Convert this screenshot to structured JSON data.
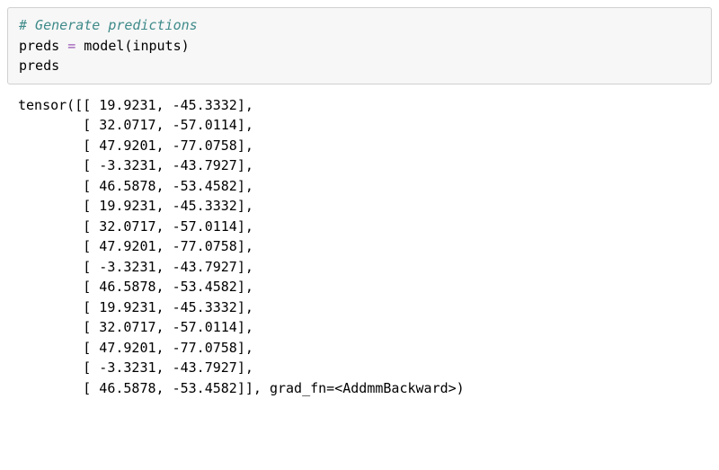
{
  "code": {
    "comment": "# Generate predictions",
    "line2_left": "preds ",
    "line2_op": "=",
    "line2_right": " model(inputs)",
    "line3": "preds"
  },
  "output": {
    "prefix": "tensor([[",
    "rows": [
      [
        " 19.9231",
        "-45.3332"
      ],
      [
        " 32.0717",
        "-57.0114"
      ],
      [
        " 47.9201",
        "-77.0758"
      ],
      [
        " -3.3231",
        "-43.7927"
      ],
      [
        " 46.5878",
        "-53.4582"
      ],
      [
        " 19.9231",
        "-45.3332"
      ],
      [
        " 32.0717",
        "-57.0114"
      ],
      [
        " 47.9201",
        "-77.0758"
      ],
      [
        " -3.3231",
        "-43.7927"
      ],
      [
        " 46.5878",
        "-53.4582"
      ],
      [
        " 19.9231",
        "-45.3332"
      ],
      [
        " 32.0717",
        "-57.0114"
      ],
      [
        " 47.9201",
        "-77.0758"
      ],
      [
        " -3.3231",
        "-43.7927"
      ],
      [
        " 46.5878",
        "-53.4582"
      ]
    ],
    "suffix": "grad_fn=<AddmmBackward>"
  }
}
